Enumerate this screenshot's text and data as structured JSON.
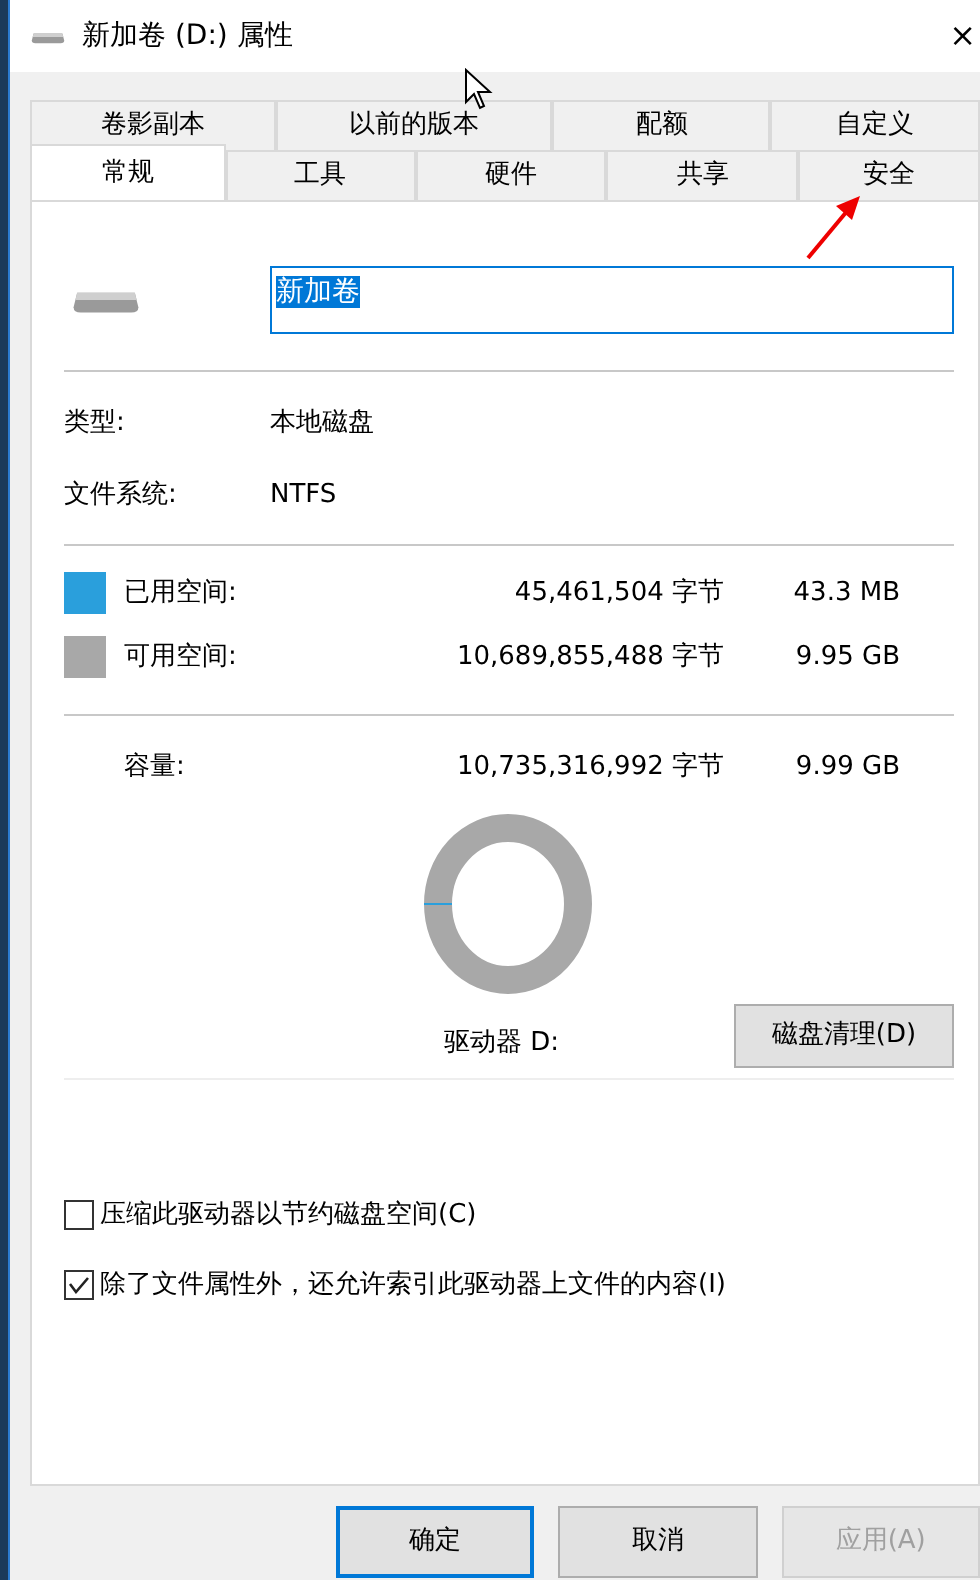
{
  "window": {
    "title": "新加卷 (D:) 属性",
    "close": "×"
  },
  "tab_rows": [
    [
      {
        "label": "卷影副本",
        "selected": false
      },
      {
        "label": "以前的版本",
        "selected": false
      },
      {
        "label": "配额",
        "selected": false
      },
      {
        "label": "自定义",
        "selected": false
      }
    ],
    [
      {
        "label": "常规",
        "selected": true
      },
      {
        "label": "工具",
        "selected": false
      },
      {
        "label": "硬件",
        "selected": false
      },
      {
        "label": "共享",
        "selected": false
      },
      {
        "label": "安全",
        "selected": false
      }
    ]
  ],
  "volume_name": {
    "value": "新加卷"
  },
  "info": [
    {
      "label": "类型:",
      "value": "本地磁盘"
    },
    {
      "label": "文件系统:",
      "value": "NTFS"
    }
  ],
  "space": [
    {
      "label": "已用空间:",
      "bytes": "45,461,504 字节",
      "size": "43.3 MB",
      "color": "#2a9fdc"
    },
    {
      "label": "可用空间:",
      "bytes": "10,689,855,488 字节",
      "size": "9.95 GB",
      "color": "#a8a8a8"
    }
  ],
  "capacity": {
    "label": "容量:",
    "bytes": "10,735,316,992 字节",
    "size": "9.99 GB"
  },
  "drive_label": "驱动器 D:",
  "cleanup_button": "磁盘清理(D)",
  "options": [
    {
      "label": "压缩此驱动器以节约磁盘空间(C)",
      "checked": false
    },
    {
      "label": "除了文件属性外，还允许索引此驱动器上文件的内容(I)",
      "checked": true
    }
  ],
  "buttons": [
    {
      "label": "确定",
      "kind": "default",
      "disabled": false
    },
    {
      "label": "取消",
      "kind": "normal",
      "disabled": false
    },
    {
      "label": "应用(A)",
      "kind": "normal",
      "disabled": true
    }
  ]
}
